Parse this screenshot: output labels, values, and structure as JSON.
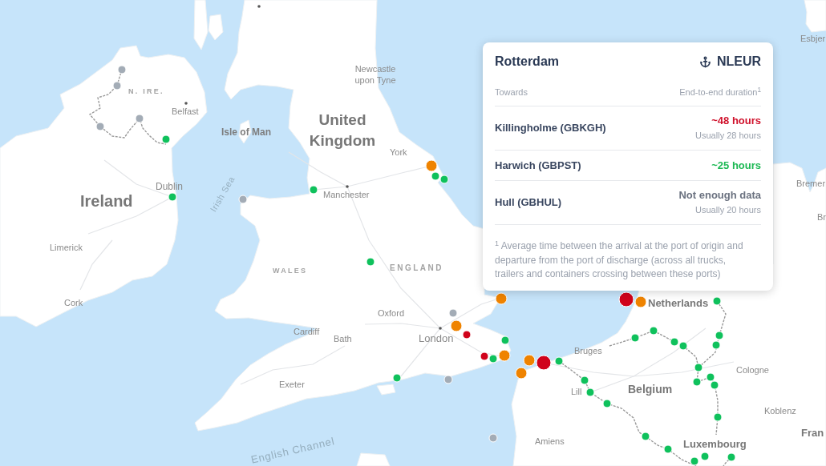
{
  "popup": {
    "title": "Rotterdam",
    "code": "NLEUR",
    "header": {
      "left": "Towards",
      "right": "End-to-end duration$^{1}$"
    },
    "routes": [
      {
        "port": "Killingholme (GBKGH)",
        "duration": "~48 hours",
        "color": "#d0112b",
        "usual": "Usually 28 hours"
      },
      {
        "port": "Harwich (GBPST)",
        "duration": "~25 hours",
        "color": "#1db954"
      },
      {
        "port": "Hull (GBHUL)",
        "duration": "Not enough data",
        "color": "#6b7280",
        "usual": "Usually 20 hours"
      }
    ],
    "footnote": "$^{1}$ Average time between the arrival at the port of origin and departure from the port of discharge (across all trucks, trailers and containers crossing between these ports)"
  },
  "map": {
    "labels": [
      {
        "text": "Esbjer",
        "kind": "city"
      },
      {
        "text": "Newcastle upon Tyne",
        "kind": "city"
      },
      {
        "text": "N. IRE.",
        "kind": "region"
      },
      {
        "text": "Belfast",
        "kind": "city"
      },
      {
        "text": "Isle of Man",
        "kind": "island"
      },
      {
        "text": "United Kingdom",
        "kind": "country"
      },
      {
        "text": "York",
        "kind": "city"
      },
      {
        "text": "Ireland",
        "kind": "country"
      },
      {
        "text": "Dublin",
        "kind": "city"
      },
      {
        "text": "Irish Sea",
        "kind": "sea"
      },
      {
        "text": "Manchester",
        "kind": "city"
      },
      {
        "text": "Bremer",
        "kind": "city"
      },
      {
        "text": "Br",
        "kind": "city"
      },
      {
        "text": "Limerick",
        "kind": "city"
      },
      {
        "text": "WALES",
        "kind": "region"
      },
      {
        "text": "ENGLAND",
        "kind": "region"
      },
      {
        "text": "Cork",
        "kind": "city"
      },
      {
        "text": "Netherlands",
        "kind": "country"
      },
      {
        "text": "Oxford",
        "kind": "city"
      },
      {
        "text": "Cardiff",
        "kind": "city"
      },
      {
        "text": "Bath",
        "kind": "city"
      },
      {
        "text": "London",
        "kind": "city"
      },
      {
        "text": "Bruges",
        "kind": "city"
      },
      {
        "text": "Cologne",
        "kind": "city"
      },
      {
        "text": "Exeter",
        "kind": "city"
      },
      {
        "text": "Lill",
        "kind": "city"
      },
      {
        "text": "Belgium",
        "kind": "country"
      },
      {
        "text": "Koblenz",
        "kind": "city"
      },
      {
        "text": "English Channel",
        "kind": "sea"
      },
      {
        "text": "Amiens",
        "kind": "city"
      },
      {
        "text": "Luxembourg",
        "kind": "country"
      },
      {
        "text": "Fran",
        "kind": "country"
      }
    ],
    "markers": [
      {
        "color": "#a3acb6",
        "kind": "small"
      },
      {
        "color": "#a3acb6",
        "kind": "small"
      },
      {
        "color": "#a3acb6",
        "kind": "small"
      },
      {
        "color": "#a3acb6",
        "kind": "small"
      },
      {
        "color": "#0fc15c",
        "kind": "small"
      },
      {
        "color": "#0fc15c",
        "kind": "small"
      },
      {
        "color": "#a3acb6",
        "kind": "small"
      },
      {
        "color": "#0fc15c",
        "kind": "small"
      },
      {
        "color": "#0fc15c",
        "kind": "small"
      },
      {
        "color": "#ef8300",
        "kind": "large"
      },
      {
        "color": "#0fc15c",
        "kind": "small"
      },
      {
        "color": "#0fc15c",
        "kind": "small"
      },
      {
        "color": "#ef8300",
        "kind": "large"
      },
      {
        "color": "#d0021b",
        "kind": "xlarge"
      },
      {
        "color": "#ef8300",
        "kind": "large"
      },
      {
        "color": "#0fc15c",
        "kind": "small"
      },
      {
        "color": "#a3acb6",
        "kind": "small"
      },
      {
        "color": "#d0021b",
        "kind": "small"
      },
      {
        "color": "#ef8300",
        "kind": "large"
      },
      {
        "color": "#0fc15c",
        "kind": "small"
      },
      {
        "color": "#0fc15c",
        "kind": "small"
      },
      {
        "color": "#0fc15c",
        "kind": "small"
      },
      {
        "color": "#0fc15c",
        "kind": "small"
      },
      {
        "color": "#0fc15c",
        "kind": "small"
      },
      {
        "color": "#0fc15c",
        "kind": "small"
      },
      {
        "color": "#0fc15c",
        "kind": "small"
      },
      {
        "color": "#d0021b",
        "kind": "small"
      },
      {
        "color": "#0fc15c",
        "kind": "small"
      },
      {
        "color": "#ef8300",
        "kind": "large"
      },
      {
        "color": "#0fc15c",
        "kind": "small"
      },
      {
        "color": "#ef8300",
        "kind": "large"
      },
      {
        "color": "#ef8300",
        "kind": "large"
      },
      {
        "color": "#d0021b",
        "kind": "xlarge"
      },
      {
        "color": "#0fc15c",
        "kind": "small"
      },
      {
        "color": "#0fc15c",
        "kind": "small"
      },
      {
        "color": "#a3acb6",
        "kind": "small"
      },
      {
        "color": "#0fc15c",
        "kind": "small"
      },
      {
        "color": "#0fc15c",
        "kind": "small"
      },
      {
        "color": "#0fc15c",
        "kind": "small"
      },
      {
        "color": "#0fc15c",
        "kind": "small"
      },
      {
        "color": "#0fc15c",
        "kind": "small"
      },
      {
        "color": "#0fc15c",
        "kind": "small"
      },
      {
        "color": "#0fc15c",
        "kind": "small"
      },
      {
        "color": "#0fc15c",
        "kind": "small"
      },
      {
        "color": "#a3acb6",
        "kind": "small"
      },
      {
        "color": "#0fc15c",
        "kind": "small"
      },
      {
        "color": "#0fc15c",
        "kind": "small"
      },
      {
        "color": "#0fc15c",
        "kind": "small"
      },
      {
        "color": "#0fc15c",
        "kind": "small"
      }
    ]
  }
}
